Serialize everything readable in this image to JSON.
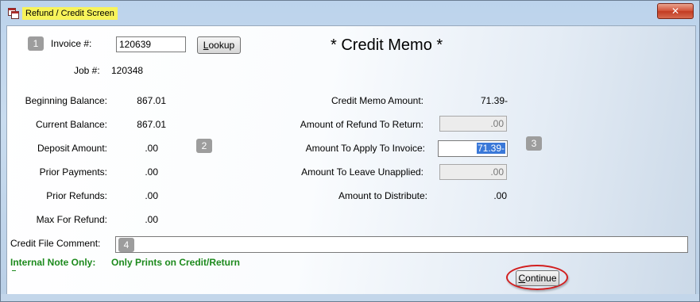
{
  "window": {
    "title": "Refund / Credit Screen",
    "close_symbol": "✕"
  },
  "markers": [
    "1",
    "2",
    "3",
    "4"
  ],
  "invoice": {
    "invoice_label": "Invoice #:",
    "invoice_value": "120639",
    "lookup_label_u": "L",
    "lookup_label_rest": "ookup",
    "job_label": "Job #:",
    "job_value": "120348"
  },
  "heading": "* Credit Memo *",
  "balances": [
    {
      "label": "Beginning Balance:",
      "value": "867.01"
    },
    {
      "label": "Current Balance:",
      "value": "867.01"
    },
    {
      "label": "Deposit Amount:",
      "value": ".00"
    },
    {
      "label": "Prior Payments:",
      "value": ".00"
    },
    {
      "label": "Prior Refunds:",
      "value": ".00"
    },
    {
      "label": "Max For Refund:",
      "value": ".00"
    }
  ],
  "credit": {
    "memo_amount_label": "Credit Memo Amount:",
    "memo_amount_value": "71.39-",
    "refund_label": "Amount of Refund To Return:",
    "refund_value": ".00",
    "apply_label": "Amount To Apply To Invoice:",
    "apply_value": "71.39-",
    "unapplied_label": "Amount To Leave Unapplied:",
    "unapplied_value": ".00",
    "distribute_label": "Amount to Distribute:",
    "distribute_value": ".00"
  },
  "comment": {
    "label": "Credit File Comment:",
    "value": ""
  },
  "note": {
    "label": "Internal Note Only:",
    "text": "Only Prints on Credit/Return"
  },
  "continue_label_u": "C",
  "continue_label_rest": "ontinue",
  "colors": {
    "title_highlight": "#f7f35a",
    "note_green": "#1d8a1d",
    "callout_red": "#d21f1f",
    "selection_blue": "#3a78d8"
  }
}
